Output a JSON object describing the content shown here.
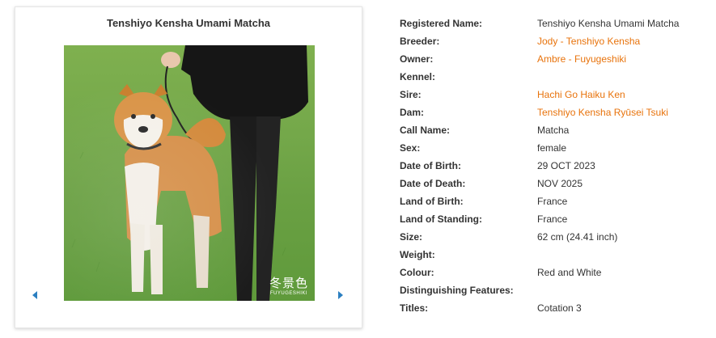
{
  "card": {
    "title": "Tenshiyo Kensha Umami Matcha",
    "watermark_jp": "冬景色",
    "watermark_en": "FUYUGESHIKI"
  },
  "details": [
    {
      "label": "Registered Name:",
      "value": "Tenshiyo Kensha Umami Matcha",
      "link": false
    },
    {
      "label": "Breeder:",
      "value": "Jody - Tenshiyo Kensha",
      "link": true
    },
    {
      "label": "Owner:",
      "value": "Ambre - Fuyugeshiki",
      "link": true
    },
    {
      "label": "Kennel:",
      "value": "",
      "link": false
    },
    {
      "label": "Sire:",
      "value": "Hachi Go Haiku Ken",
      "link": true
    },
    {
      "label": "Dam:",
      "value": "Tenshiyo Kensha Ryūsei Tsuki",
      "link": true
    },
    {
      "label": "Call Name:",
      "value": "Matcha",
      "link": false
    },
    {
      "label": "Sex:",
      "value": "female",
      "link": false
    },
    {
      "label": "Date of Birth:",
      "value": "29 OCT 2023",
      "link": false
    },
    {
      "label": "Date of Death:",
      "value": "NOV 2025",
      "link": false
    },
    {
      "label": "Land of Birth:",
      "value": "France",
      "link": false
    },
    {
      "label": "Land of Standing:",
      "value": "France",
      "link": false
    },
    {
      "label": "Size:",
      "value": "62 cm (24.41 inch)",
      "link": false
    },
    {
      "label": "Weight:",
      "value": "",
      "link": false
    },
    {
      "label": "Colour:",
      "value": "Red and White",
      "link": false
    },
    {
      "label": "Distinguishing Features:",
      "value": "",
      "link": false
    },
    {
      "label": "Titles:",
      "value": "Cotation 3",
      "link": false
    }
  ]
}
